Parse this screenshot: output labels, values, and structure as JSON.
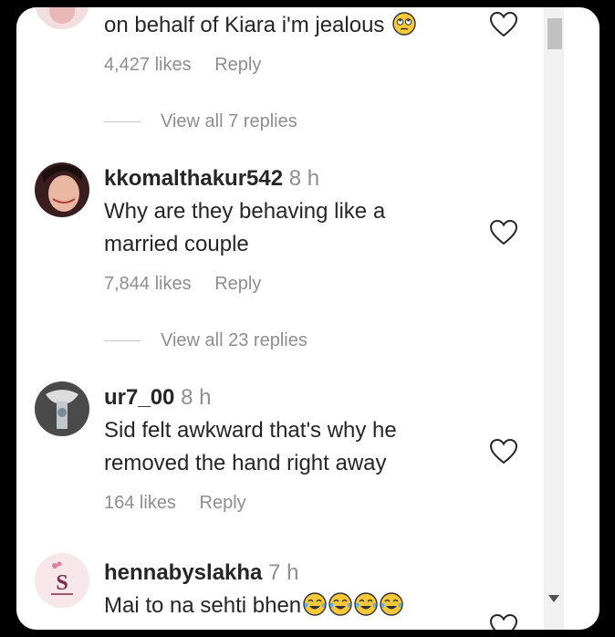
{
  "comments": [
    {
      "username": "",
      "time": "",
      "text": "on behalf of Kiara i'm jealous",
      "likes": "4,427 likes",
      "reply": "Reply",
      "view_replies": "View all 7 replies"
    },
    {
      "username": "kkomalthakur542",
      "time": "8 h",
      "text_line1": "Why are they behaving like a",
      "text_line2": "married couple",
      "likes": "7,844 likes",
      "reply": "Reply",
      "view_replies": "View all 23 replies"
    },
    {
      "username": "ur7_00",
      "time": "8 h",
      "text_line1": "Sid felt awkward that's why he",
      "text_line2": "removed the hand right away",
      "likes": "164 likes",
      "reply": "Reply"
    },
    {
      "username": "hennabyslakha",
      "time": "7 h",
      "text": "Mai to na sehti bhen",
      "avatar_letter": "S"
    }
  ],
  "icons": {
    "heart": "heart-outline-icon",
    "emoji_eyeroll": "face-with-rolling-eyes-emoji",
    "emoji_laugh": "face-with-tears-of-joy-emoji"
  },
  "colors": {
    "text": "#262626",
    "secondary": "#8e8e8e",
    "background": "#ffffff"
  }
}
